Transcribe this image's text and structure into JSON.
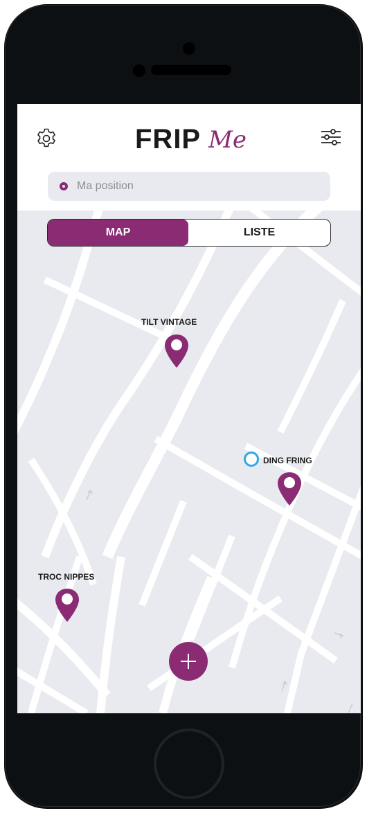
{
  "header": {
    "logo_main": "FRIP",
    "logo_script": "Me",
    "settings_icon": "gear-icon",
    "filter_icon": "sliders-icon"
  },
  "search": {
    "placeholder": "Ma position"
  },
  "view_toggle": {
    "map_label": "MAP",
    "list_label": "LISTE",
    "selected": "MAP"
  },
  "map": {
    "shops": [
      {
        "name": "TILT VINTAGE"
      },
      {
        "name": "DING FRING"
      },
      {
        "name": "TROC NIPPES"
      }
    ],
    "current_location_icon": "current-location-icon"
  },
  "fab": {
    "icon": "plus-icon"
  },
  "colors": {
    "accent": "#8a2b73",
    "map_bg": "#e8eaf0",
    "road": "#ffffff",
    "location_dot": "#31a7e7"
  }
}
